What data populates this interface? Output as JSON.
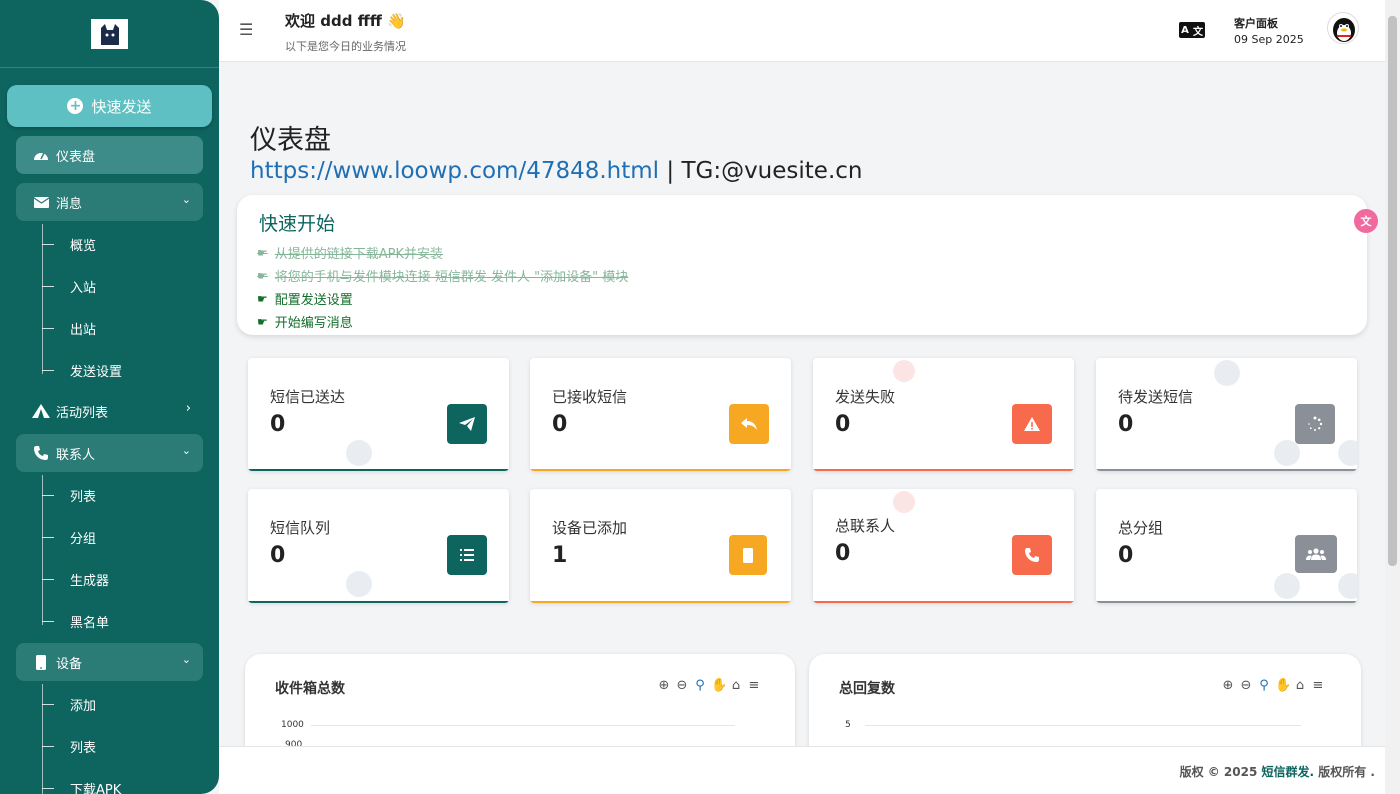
{
  "sidebar": {
    "quick_send": "快速发送",
    "items": [
      {
        "label": "仪表盘",
        "icon": "dashboard-icon"
      },
      {
        "label": "消息",
        "icon": "envelope-icon",
        "children": [
          "概览",
          "入站",
          "出站",
          "发送设置"
        ]
      },
      {
        "label": "活动列表",
        "icon": "campaign-icon"
      },
      {
        "label": "联系人",
        "icon": "phone-icon",
        "children": [
          "列表",
          "分组",
          "生成器",
          "黑名单"
        ]
      },
      {
        "label": "设备",
        "icon": "mobile-icon",
        "children": [
          "添加",
          "列表",
          "下载APK"
        ]
      }
    ]
  },
  "header": {
    "welcome": "欢迎 ddd ffff 👋",
    "subtitle": "以下是您今日的业务情况",
    "panel_label": "客户面板",
    "date": "09 Sep 2025"
  },
  "main": {
    "title": "仪表盘",
    "link_url": "https://www.loowp.com/47848.html",
    "link_suffix": " | TG:@vuesite.cn",
    "quick_start": {
      "title": "快速开始",
      "steps": [
        {
          "text": "从提供的链接下载APK并安装",
          "done": true
        },
        {
          "text": "将您的手机与发件模块连接 短信群发 发件人 \"添加设备\" 模块",
          "done": true
        },
        {
          "text": "配置发送设置",
          "done": false
        },
        {
          "text": "开始编写消息",
          "done": false
        }
      ]
    },
    "stats": [
      {
        "label": "短信已送达",
        "value": "0",
        "icon": "paper-plane-icon",
        "color": "#0e6560"
      },
      {
        "label": "已接收短信",
        "value": "0",
        "icon": "reply-icon",
        "color": "#f7a823"
      },
      {
        "label": "发送失败",
        "value": "0",
        "icon": "warning-icon",
        "color": "#f76a4c"
      },
      {
        "label": "待发送短信",
        "value": "0",
        "icon": "spinner-icon",
        "color": "#8a8f98"
      },
      {
        "label": "短信队列",
        "value": "0",
        "icon": "list-icon",
        "color": "#0e6560"
      },
      {
        "label": "设备已添加",
        "value": "1",
        "icon": "mobile-icon",
        "color": "#f7a823"
      },
      {
        "label": "总联系人",
        "value": "0",
        "icon": "phone-icon",
        "color": "#f76a4c"
      },
      {
        "label": "总分组",
        "value": "0",
        "icon": "users-icon",
        "color": "#8a8f98"
      }
    ],
    "charts": [
      {
        "title": "收件箱总数",
        "ticks": [
          "1000",
          "900"
        ]
      },
      {
        "title": "总回复数",
        "ticks": [
          "5"
        ]
      }
    ]
  },
  "footer": {
    "prefix": "版权 © 2025 ",
    "brand": "短信群发.",
    "suffix": " 版权所有 ."
  },
  "colors": {
    "sidebar": "#0e6560",
    "accent": "#5fc0c3"
  }
}
